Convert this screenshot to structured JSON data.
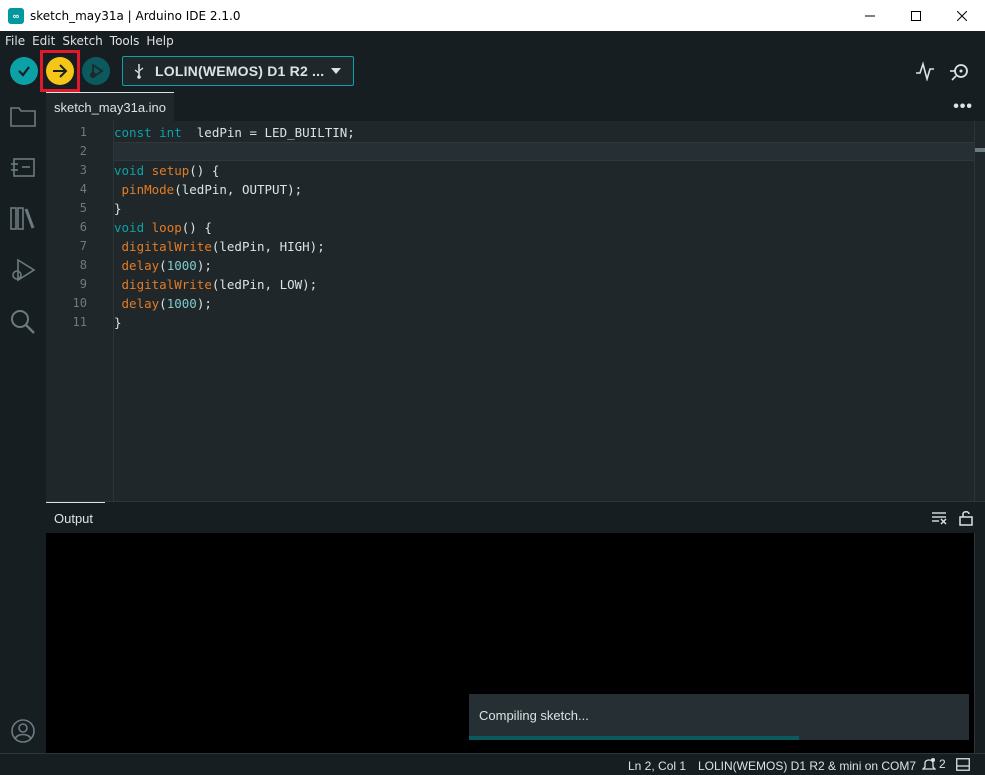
{
  "window": {
    "title": "sketch_may31a | Arduino IDE 2.1.0",
    "logo": "∞"
  },
  "menu": [
    "File",
    "Edit",
    "Sketch",
    "Tools",
    "Help"
  ],
  "toolbar": {
    "board": "LOLIN(WEMOS) D1 R2 ...",
    "accent": "#0ca1a6",
    "upload_color": "#f5c518",
    "highlight_color": "#e0192b"
  },
  "editor": {
    "tab": "sketch_may31a.ino",
    "more": "•••",
    "line_numbers": [
      "1",
      "2",
      "3",
      "4",
      "5",
      "6",
      "7",
      "8",
      "9",
      "10",
      "11"
    ],
    "lines": [
      [
        [
          "kw",
          "const "
        ],
        [
          "kw",
          "int"
        ],
        [
          "",
          "  ledPin = LED_BUILTIN;"
        ]
      ],
      [],
      [
        [
          "kw",
          "void"
        ],
        [
          "",
          " "
        ],
        [
          "fn",
          "setup"
        ],
        [
          "",
          "() {"
        ]
      ],
      [
        [
          "",
          " "
        ],
        [
          "fn",
          "pinMode"
        ],
        [
          "",
          "(ledPin, OUTPUT);"
        ]
      ],
      [
        [
          "",
          "}"
        ]
      ],
      [
        [
          "kw",
          "void"
        ],
        [
          "",
          " "
        ],
        [
          "fn",
          "loop"
        ],
        [
          "",
          "() {"
        ]
      ],
      [
        [
          "",
          " "
        ],
        [
          "fn",
          "digitalWrite"
        ],
        [
          "",
          "(ledPin, HIGH);"
        ]
      ],
      [
        [
          "",
          " "
        ],
        [
          "fn",
          "delay"
        ],
        [
          "",
          "("
        ],
        [
          "num",
          "1000"
        ],
        [
          "",
          ");"
        ]
      ],
      [
        [
          "",
          " "
        ],
        [
          "fn",
          "digitalWrite"
        ],
        [
          "",
          "(ledPin, LOW);"
        ]
      ],
      [
        [
          "",
          " "
        ],
        [
          "fn",
          "delay"
        ],
        [
          "",
          "("
        ],
        [
          "num",
          "1000"
        ],
        [
          "",
          ");"
        ]
      ],
      [
        [
          "",
          "}"
        ]
      ]
    ]
  },
  "output": {
    "title": "Output"
  },
  "notification": {
    "text": "Compiling sketch...",
    "progress": 0.66
  },
  "status": {
    "position": "Ln 2, Col 1",
    "board": "LOLIN(WEMOS) D1 R2 & mini on COM7",
    "notifications": "2"
  }
}
